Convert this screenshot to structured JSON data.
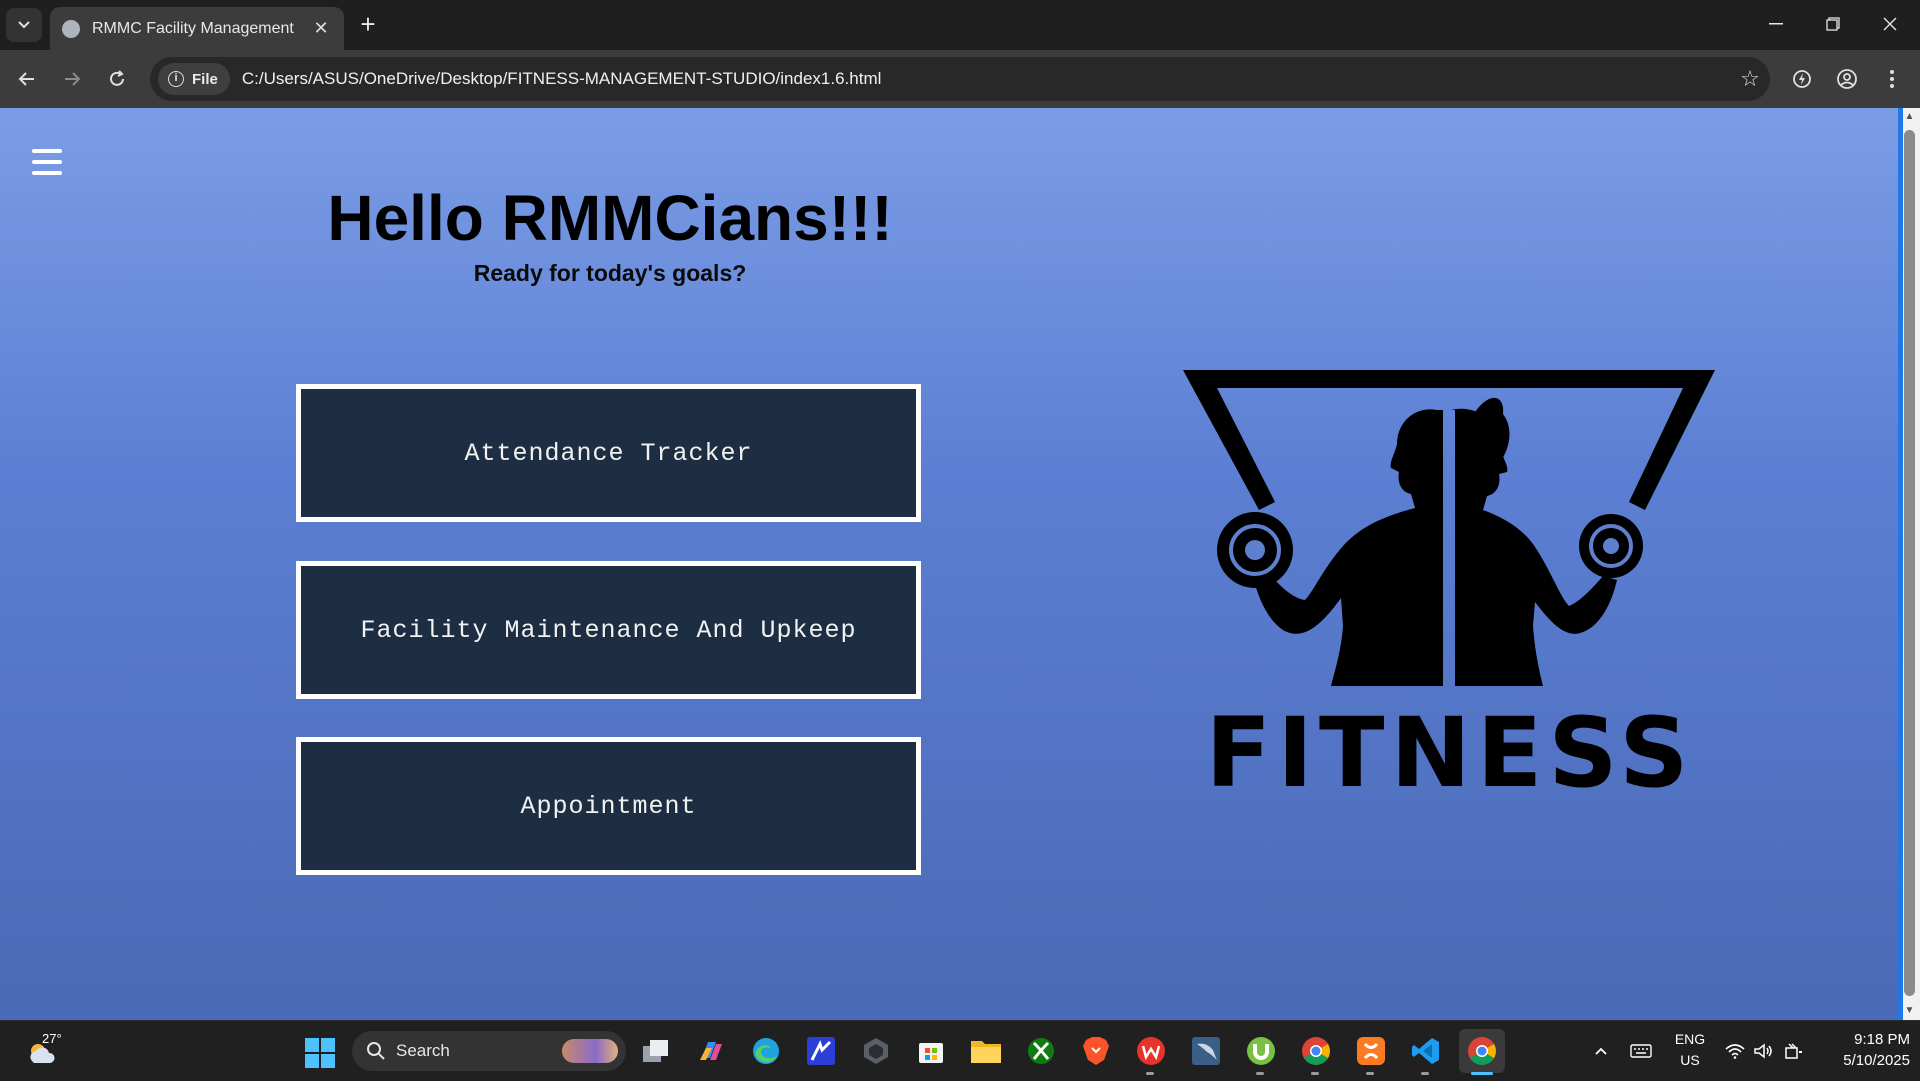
{
  "browser": {
    "tab_title": "RMMC Facility Management",
    "site_chip": "File",
    "url": "C:/Users/ASUS/OneDrive/Desktop/FITNESS-MANAGEMENT-STUDIO/index1.6.html"
  },
  "page": {
    "title": "Hello RMMCians!!!",
    "subtitle": "Ready for today's goals?",
    "buttons": [
      {
        "label": "Attendance Tracker"
      },
      {
        "label": "Facility Maintenance And Upkeep"
      },
      {
        "label": "Appointment"
      }
    ],
    "logo_text": "FITNESS",
    "colors": {
      "button_bg": "#1e2e42",
      "button_border": "#ffffff",
      "gradient_top": "#7b9de6",
      "gradient_bottom": "#4a69b6"
    }
  },
  "taskbar": {
    "weather_temp": "27°",
    "search_label": "Search",
    "language": "ENG",
    "region": "US",
    "time": "9:18 PM",
    "date": "5/10/2025",
    "apps": [
      "task-view-icon",
      "copilot-icon",
      "edge-icon",
      "app-icon",
      "app-icon",
      "store-icon",
      "file-explorer-icon",
      "xbox-icon",
      "brave-icon",
      "wps-icon",
      "mysql-workbench-icon",
      "utorrent-icon",
      "chrome-icon",
      "xampp-icon",
      "vscode-icon",
      "chrome-active-icon"
    ]
  }
}
